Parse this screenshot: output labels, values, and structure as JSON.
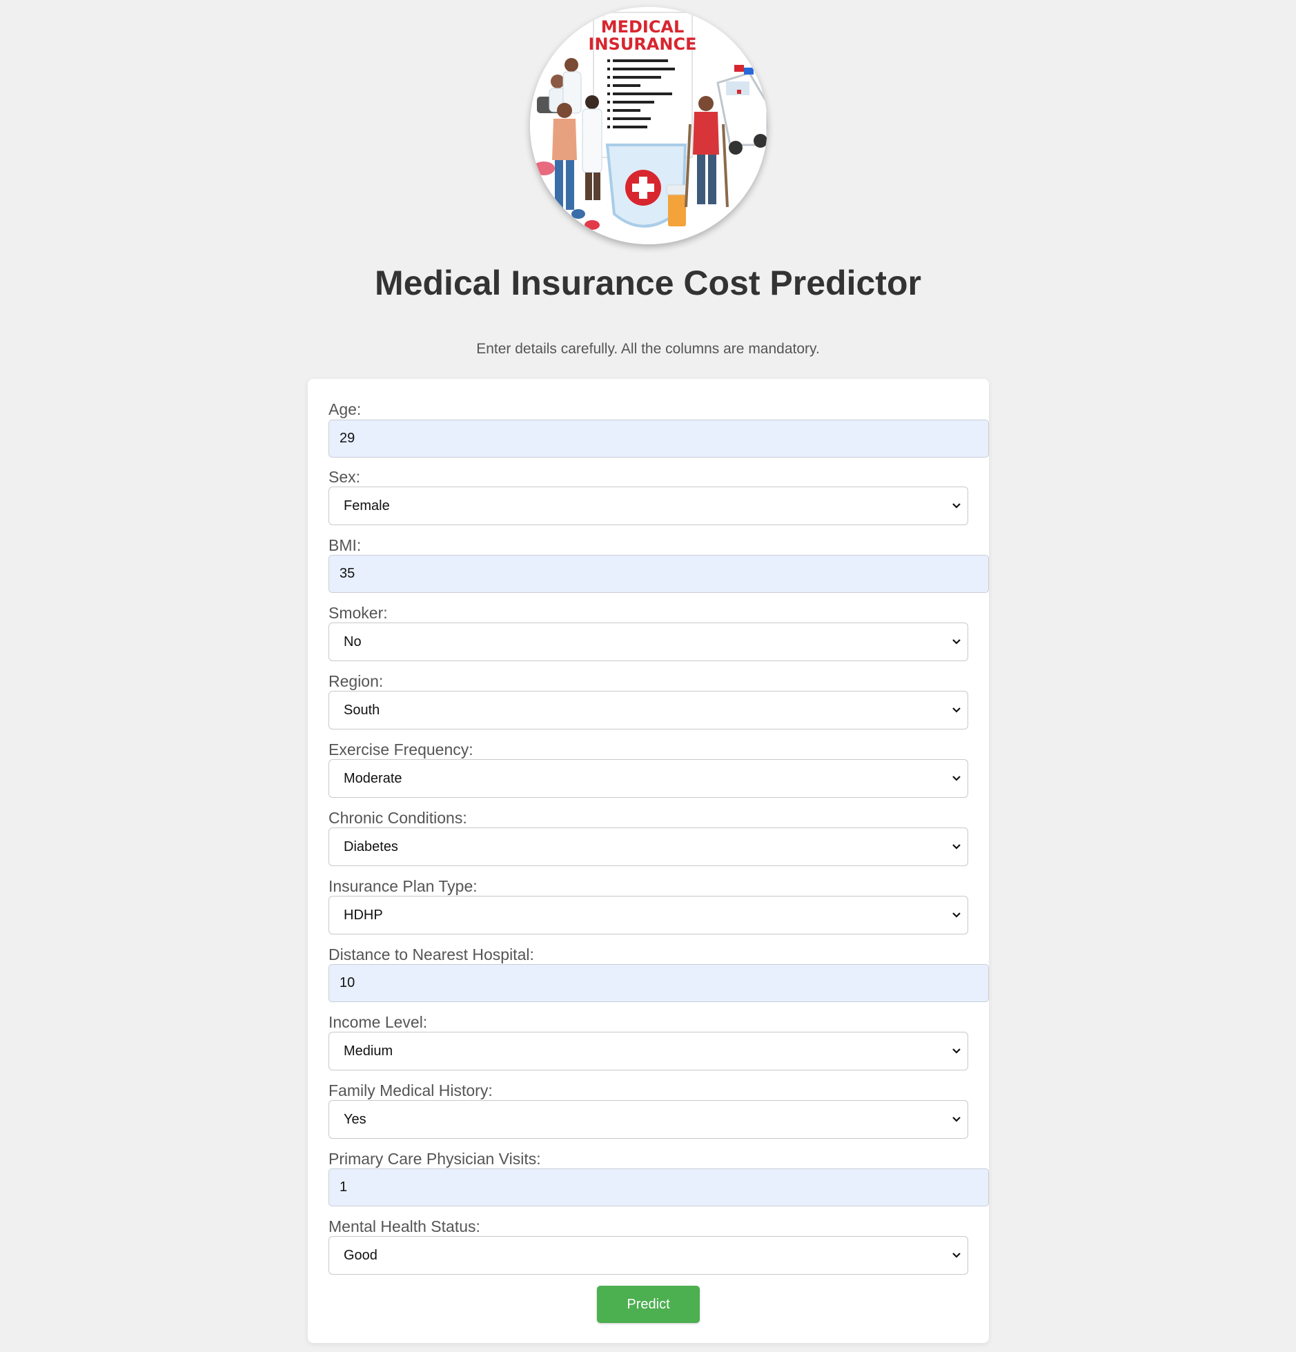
{
  "header": {
    "logo_line1": "MEDICAL",
    "logo_line2": "INSURANCE",
    "title": "Medical Insurance Cost Predictor",
    "subtitle": "Enter details carefully. All the columns are mandatory."
  },
  "form": {
    "age": {
      "label": "Age:",
      "value": "29"
    },
    "sex": {
      "label": "Sex:",
      "value": "Female"
    },
    "bmi": {
      "label": "BMI:",
      "value": "35"
    },
    "smoker": {
      "label": "Smoker:",
      "value": "No"
    },
    "region": {
      "label": "Region:",
      "value": "South"
    },
    "exercise": {
      "label": "Exercise Frequency:",
      "value": "Moderate"
    },
    "chronic": {
      "label": "Chronic Conditions:",
      "value": "Diabetes"
    },
    "plan": {
      "label": "Insurance Plan Type:",
      "value": "HDHP"
    },
    "distance": {
      "label": "Distance to Nearest Hospital:",
      "value": "10"
    },
    "income": {
      "label": "Income Level:",
      "value": "Medium"
    },
    "family_history": {
      "label": "Family Medical History:",
      "value": "Yes"
    },
    "visits": {
      "label": "Primary Care Physician Visits:",
      "value": "1"
    },
    "mental": {
      "label": "Mental Health Status:",
      "value": "Good"
    },
    "submit_label": "Predict"
  },
  "colors": {
    "background": "#f0f0f0",
    "card": "#ffffff",
    "input_fill": "#e8f0fe",
    "button": "#4caf50",
    "title_text": "#333333",
    "logo_red": "#d8262f"
  }
}
